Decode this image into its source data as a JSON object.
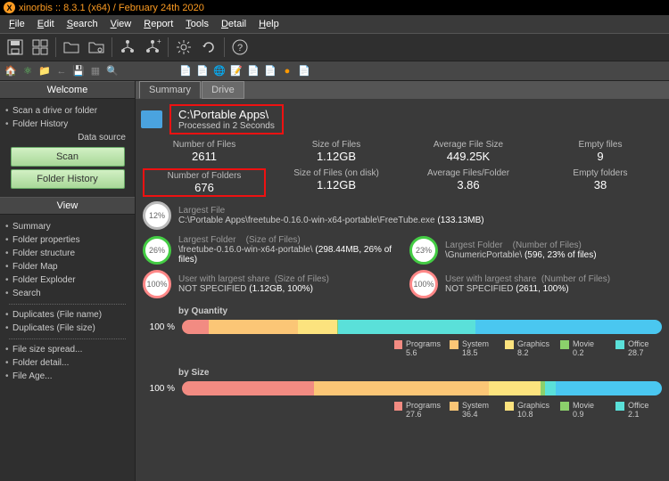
{
  "titlebar": "xinorbis :: 8.3.1 (x64) / February 24th 2020",
  "menu": [
    "File",
    "Edit",
    "Search",
    "View",
    "Report",
    "Tools",
    "Detail",
    "Help"
  ],
  "sidebar": {
    "welcome": "Welcome",
    "top_items": [
      "Scan a drive or folder",
      "Folder History"
    ],
    "ds_label": "Data source",
    "scan_btn": "Scan",
    "fh_btn": "Folder History",
    "view": "View",
    "group1": [
      "Summary",
      "Folder properties",
      "Folder structure",
      "Folder Map",
      "Folder Exploder",
      "Search"
    ],
    "group2": [
      "Duplicates (File name)",
      "Duplicates (File size)"
    ],
    "group3": [
      "File size spread...",
      "Folder detail...",
      "File Age..."
    ]
  },
  "tabs": [
    "Summary",
    "Drive"
  ],
  "path": "C:\\Portable Apps\\",
  "path_sub": "Processed in 2 Seconds",
  "stats1": [
    {
      "label": "Number of Files",
      "val": "2611"
    },
    {
      "label": "Size of Files",
      "val": "1.12GB"
    },
    {
      "label": "Average File Size",
      "val": "449.25K"
    },
    {
      "label": "Empty files",
      "val": "9"
    }
  ],
  "stats2": [
    {
      "label": "Number of Folders",
      "val": "676"
    },
    {
      "label": "Size of Files (on disk)",
      "val": "1.12GB"
    },
    {
      "label": "Average Files/Folder",
      "val": "3.86"
    },
    {
      "label": "Empty folders",
      "val": "38"
    }
  ],
  "largest_file": {
    "pct": "12%",
    "label": "Largest File",
    "path": "C:\\Portable Apps\\freetube-0.16.0-win-x64-portable\\FreeTube.exe",
    "size": "(133.13MB)"
  },
  "largest_folder_l": {
    "pct": "26%",
    "label": "Largest Folder",
    "sub": "(Size of Files)",
    "path": "\\freetube-0.16.0-win-x64-portable\\",
    "extra": "(298.44MB, 26% of files)"
  },
  "largest_folder_r": {
    "pct": "23%",
    "label": "Largest Folder",
    "sub": "(Number of Files)",
    "path": "\\GnumericPortable\\",
    "extra": "(596, 23% of files)"
  },
  "user_l": {
    "pct": "100%",
    "label": "User with largest share",
    "sub": "(Size of Files)",
    "path": "NOT SPECIFIED",
    "extra": "(1.12GB, 100%)"
  },
  "user_r": {
    "pct": "100%",
    "label": "User with largest share",
    "sub": "(Number of Files)",
    "path": "NOT SPECIFIED",
    "extra": "(2611, 100%)"
  },
  "chart_data": [
    {
      "type": "bar",
      "title": "by Quantity",
      "pct_label": "100 %",
      "series": [
        {
          "name": "Programs",
          "value": 5.6,
          "color": "#f28b82"
        },
        {
          "name": "System",
          "value": 18.5,
          "color": "#fbc676"
        },
        {
          "name": "Graphics",
          "value": 8.2,
          "color": "#fce37e"
        },
        {
          "name": "Movie",
          "value": 0.2,
          "color": "#8bd06b"
        },
        {
          "name": "Office",
          "value": 28.7,
          "color": "#5ae0d9"
        }
      ],
      "rest_color": "#4ac7f0"
    },
    {
      "type": "bar",
      "title": "by Size",
      "pct_label": "100 %",
      "series": [
        {
          "name": "Programs",
          "value": 27.6,
          "color": "#f28b82"
        },
        {
          "name": "System",
          "value": 36.4,
          "color": "#fbc676"
        },
        {
          "name": "Graphics",
          "value": 10.8,
          "color": "#fce37e"
        },
        {
          "name": "Movie",
          "value": 0.9,
          "color": "#8bd06b"
        },
        {
          "name": "Office",
          "value": 2.1,
          "color": "#5ae0d9"
        }
      ],
      "rest_color": "#4ac7f0"
    }
  ]
}
